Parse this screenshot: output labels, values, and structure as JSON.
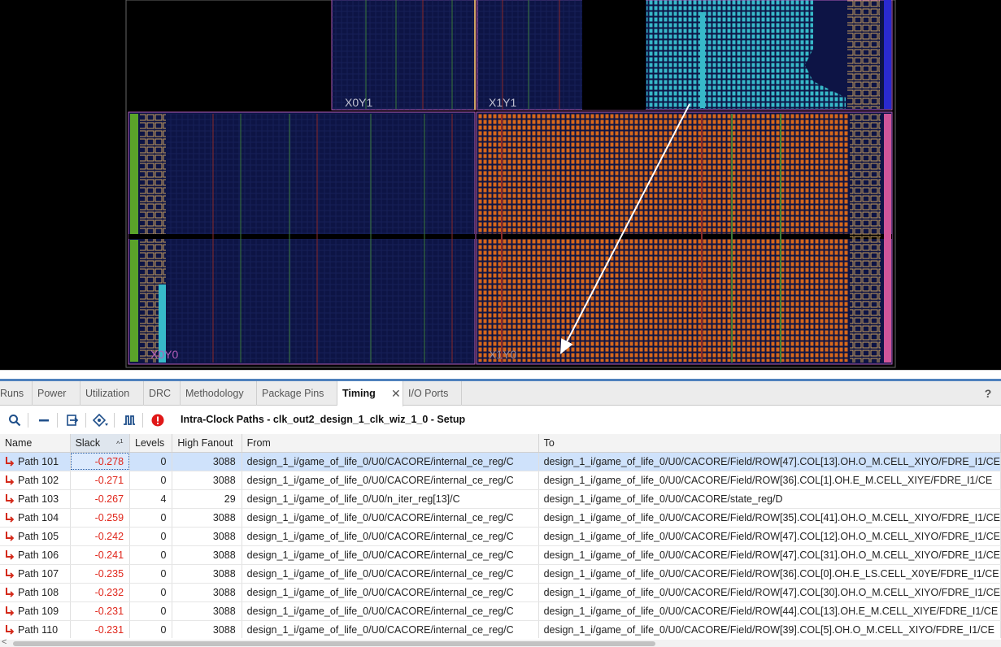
{
  "device": {
    "region_labels": [
      "X0Y1",
      "X1Y1",
      "X0Y0",
      "X1Y0"
    ],
    "colors": {
      "background": "#000000",
      "region_fill": "#0d1445",
      "region_border": "#b15cb9",
      "placed_cells": "#d7671b",
      "path_highlight_cells": "#37b9c9",
      "path_arrow": "#ffffff"
    }
  },
  "tabs": [
    {
      "label": "Runs"
    },
    {
      "label": "Power"
    },
    {
      "label": "Utilization"
    },
    {
      "label": "DRC"
    },
    {
      "label": "Methodology"
    },
    {
      "label": "Package Pins"
    },
    {
      "label": "Timing",
      "active": true,
      "closable": true
    },
    {
      "label": "I/O Ports"
    }
  ],
  "help_label": "?",
  "toolbar": {
    "icons": [
      "search-icon",
      "collapse-icon",
      "export-icon",
      "schematic-icon",
      "waveform-icon",
      "error-icon"
    ],
    "title": "Intra-Clock Paths - clk_out2_design_1_clk_wiz_1_0 - Setup"
  },
  "table": {
    "columns": [
      "Name",
      "Slack",
      "Levels",
      "High Fanout",
      "From",
      "To"
    ],
    "sort": {
      "column": "Slack",
      "direction": "ascending",
      "order": "1"
    },
    "selected_row": 0,
    "rows": [
      {
        "name": "Path 101",
        "slack": "-0.278",
        "levels": "0",
        "fanout": "3088",
        "from": "design_1_i/game_of_life_0/U0/CACORE/internal_ce_reg/C",
        "to": "design_1_i/game_of_life_0/U0/CACORE/Field/ROW[47].COL[13].OH.O_M.CELL_XIYO/FDRE_I1/CE"
      },
      {
        "name": "Path 102",
        "slack": "-0.271",
        "levels": "0",
        "fanout": "3088",
        "from": "design_1_i/game_of_life_0/U0/CACORE/internal_ce_reg/C",
        "to": "design_1_i/game_of_life_0/U0/CACORE/Field/ROW[36].COL[1].OH.E_M.CELL_XIYE/FDRE_I1/CE"
      },
      {
        "name": "Path 103",
        "slack": "-0.267",
        "levels": "4",
        "fanout": "29",
        "from": "design_1_i/game_of_life_0/U0/n_iter_reg[13]/C",
        "to": "design_1_i/game_of_life_0/U0/CACORE/state_reg/D"
      },
      {
        "name": "Path 104",
        "slack": "-0.259",
        "levels": "0",
        "fanout": "3088",
        "from": "design_1_i/game_of_life_0/U0/CACORE/internal_ce_reg/C",
        "to": "design_1_i/game_of_life_0/U0/CACORE/Field/ROW[35].COL[41].OH.O_M.CELL_XIYO/FDRE_I1/CE"
      },
      {
        "name": "Path 105",
        "slack": "-0.242",
        "levels": "0",
        "fanout": "3088",
        "from": "design_1_i/game_of_life_0/U0/CACORE/internal_ce_reg/C",
        "to": "design_1_i/game_of_life_0/U0/CACORE/Field/ROW[47].COL[12].OH.O_M.CELL_XIYO/FDRE_I1/CE"
      },
      {
        "name": "Path 106",
        "slack": "-0.241",
        "levels": "0",
        "fanout": "3088",
        "from": "design_1_i/game_of_life_0/U0/CACORE/internal_ce_reg/C",
        "to": "design_1_i/game_of_life_0/U0/CACORE/Field/ROW[47].COL[31].OH.O_M.CELL_XIYO/FDRE_I1/CE"
      },
      {
        "name": "Path 107",
        "slack": "-0.235",
        "levels": "0",
        "fanout": "3088",
        "from": "design_1_i/game_of_life_0/U0/CACORE/internal_ce_reg/C",
        "to": "design_1_i/game_of_life_0/U0/CACORE/Field/ROW[36].COL[0].OH.E_LS.CELL_X0YE/FDRE_I1/CE"
      },
      {
        "name": "Path 108",
        "slack": "-0.232",
        "levels": "0",
        "fanout": "3088",
        "from": "design_1_i/game_of_life_0/U0/CACORE/internal_ce_reg/C",
        "to": "design_1_i/game_of_life_0/U0/CACORE/Field/ROW[47].COL[30].OH.O_M.CELL_XIYO/FDRE_I1/CE"
      },
      {
        "name": "Path 109",
        "slack": "-0.231",
        "levels": "0",
        "fanout": "3088",
        "from": "design_1_i/game_of_life_0/U0/CACORE/internal_ce_reg/C",
        "to": "design_1_i/game_of_life_0/U0/CACORE/Field/ROW[44].COL[13].OH.E_M.CELL_XIYE/FDRE_I1/CE"
      },
      {
        "name": "Path 110",
        "slack": "-0.231",
        "levels": "0",
        "fanout": "3088",
        "from": "design_1_i/game_of_life_0/U0/CACORE/internal_ce_reg/C",
        "to": "design_1_i/game_of_life_0/U0/CACORE/Field/ROW[39].COL[5].OH.O_M.CELL_XIYO/FDRE_I1/CE"
      }
    ]
  }
}
